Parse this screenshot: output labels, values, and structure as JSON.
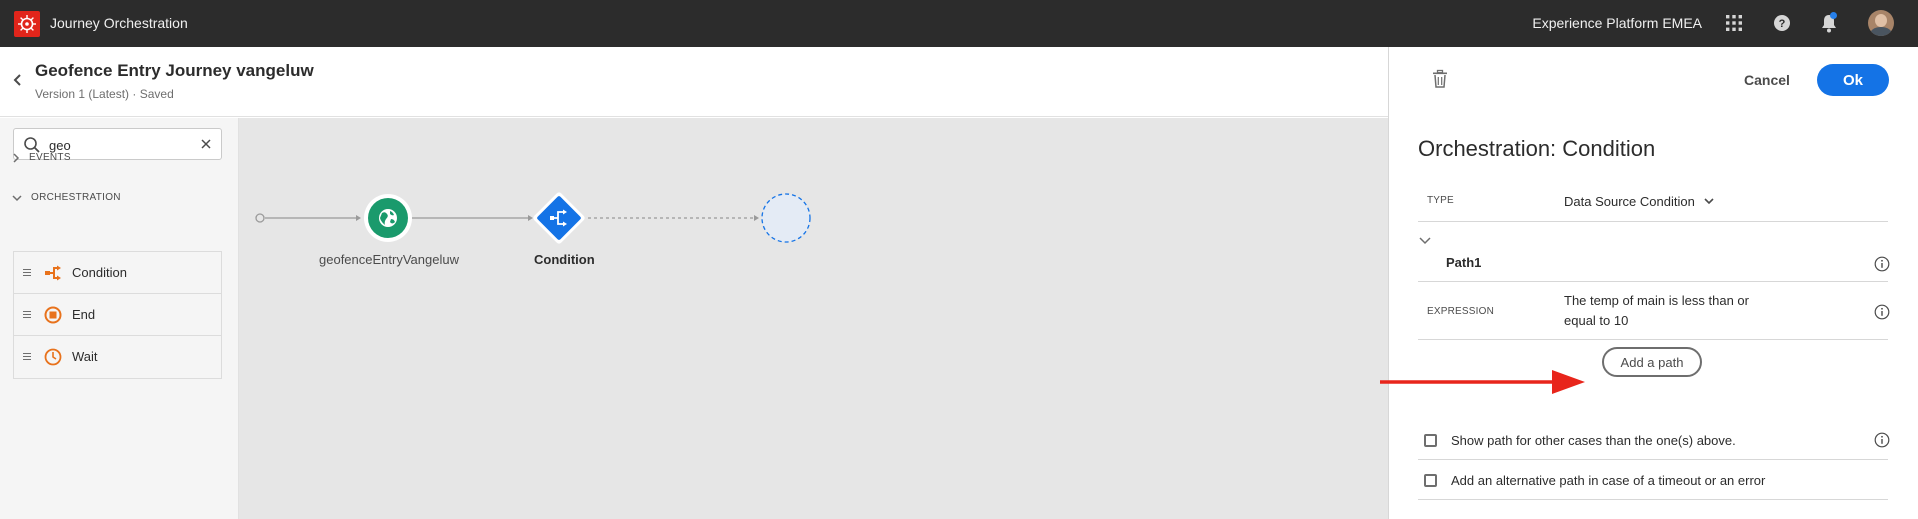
{
  "topbar": {
    "app_title": "Journey Orchestration",
    "org_name": "Experience Platform EMEA",
    "icons": [
      "apps-grid-icon",
      "help-icon",
      "notification-bell-icon",
      "user-avatar"
    ]
  },
  "journey": {
    "title": "Geofence Entry Journey vangeluw",
    "version": "Version 1 (Latest) · Saved"
  },
  "sidebar": {
    "search": {
      "value": "geo",
      "placeholder": "Search"
    },
    "sections": [
      {
        "label": "EVENTS",
        "expanded": false
      },
      {
        "label": "ORCHESTRATION",
        "expanded": true
      }
    ],
    "items": [
      {
        "label": "Condition",
        "icon": "condition-icon"
      },
      {
        "label": "End",
        "icon": "end-icon"
      },
      {
        "label": "Wait",
        "icon": "wait-icon"
      }
    ]
  },
  "canvas": {
    "nodes": [
      {
        "label": "geofenceEntryVangeluw",
        "icon": "globe-icon"
      },
      {
        "label": "Condition",
        "icon": "condition-icon"
      }
    ]
  },
  "panel": {
    "cancel_label": "Cancel",
    "ok_label": "Ok",
    "title": "Orchestration: Condition",
    "type_label": "TYPE",
    "type_value": "Data Source Condition",
    "path_name": "Path1",
    "expression_label": "EXPRESSION",
    "expression_value": "The temp of main is less than or equal to 10",
    "add_path_label": "Add a path",
    "options": [
      {
        "label": "Show path for other cases than the one(s) above.",
        "checked": false
      },
      {
        "label": "Add an alternative path in case of a timeout or an error",
        "checked": false
      }
    ]
  },
  "colors": {
    "topbar_bg": "#2c2c2c",
    "brand_red": "#e1251b",
    "accent_blue": "#1473e6",
    "orchestration_orange": "#e8721c",
    "event_green": "#1a9a6c",
    "annotation_arrow": "#e8251b"
  }
}
